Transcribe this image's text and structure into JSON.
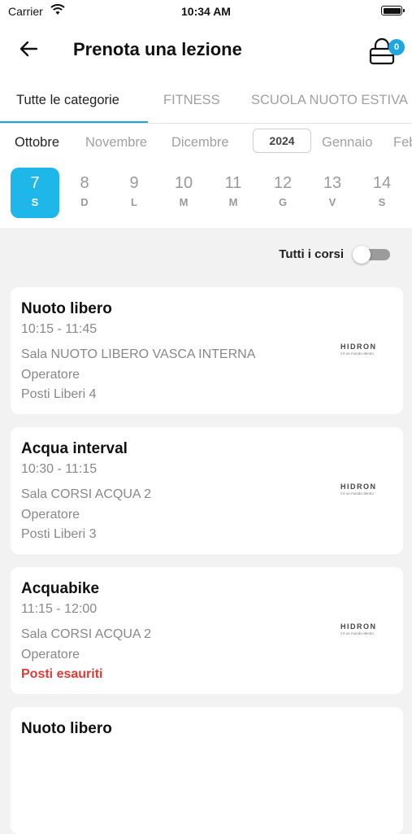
{
  "status_bar": {
    "carrier": "Carrier",
    "time": "10:34 AM"
  },
  "header": {
    "title": "Prenota una lezione",
    "cart_count": "0"
  },
  "categories": [
    {
      "label": "Tutte le categorie",
      "active": true
    },
    {
      "label": "FITNESS",
      "active": false
    },
    {
      "label": "SCUOLA NUOTO ESTIVA",
      "active": false
    }
  ],
  "months": {
    "items": [
      {
        "label": "Ottobre",
        "active": true
      },
      {
        "label": "Novembre",
        "active": false
      },
      {
        "label": "Dicembre",
        "active": false
      },
      {
        "label": "Gennaio",
        "active": false
      },
      {
        "label": "Feb",
        "active": false
      }
    ],
    "year": "2024"
  },
  "days": [
    {
      "num": "7",
      "dow": "S",
      "active": true
    },
    {
      "num": "8",
      "dow": "D",
      "active": false
    },
    {
      "num": "9",
      "dow": "L",
      "active": false
    },
    {
      "num": "10",
      "dow": "M",
      "active": false
    },
    {
      "num": "11",
      "dow": "M",
      "active": false
    },
    {
      "num": "12",
      "dow": "G",
      "active": false
    },
    {
      "num": "13",
      "dow": "V",
      "active": false
    },
    {
      "num": "14",
      "dow": "S",
      "active": false
    }
  ],
  "filter": {
    "label": "Tutti i corsi",
    "on": false
  },
  "logo": {
    "word": "HIDRON",
    "sub": "c'è un mondo dentro"
  },
  "lessons": [
    {
      "name": "Nuoto libero",
      "time": "10:15 - 11:45",
      "room": "Sala NUOTO LIBERO VASCA INTERNA",
      "operator": "Operatore",
      "seats": "Posti Liberi 4",
      "full": false
    },
    {
      "name": "Acqua interval",
      "time": "10:30 - 11:15",
      "room": "Sala CORSI ACQUA 2",
      "operator": "Operatore",
      "seats": "Posti Liberi 3",
      "full": false
    },
    {
      "name": "Acquabike",
      "time": "11:15 - 12:00",
      "room": "Sala CORSI ACQUA 2",
      "operator": "Operatore",
      "seats": "Posti esauriti",
      "full": true
    },
    {
      "name": "Nuoto libero",
      "time": "",
      "room": "",
      "operator": "",
      "seats": "",
      "full": false
    }
  ],
  "colors": {
    "accent": "#1fb6ea",
    "sold_out": "#e53935"
  }
}
